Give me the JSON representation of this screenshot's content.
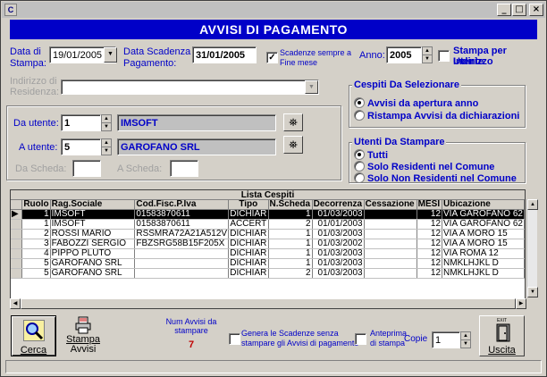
{
  "window": {
    "icon_letter": "C"
  },
  "banner": {
    "title": "AVVISI DI PAGAMENTO"
  },
  "form": {
    "data_stampa_label_1": "Data di",
    "data_stampa_label_2": "Stampa:",
    "data_stampa_value": "19/01/2005",
    "data_scadenza_label_1": "Data Scadenza",
    "data_scadenza_label_2": "Pagamento:",
    "data_scadenza_value": "31/01/2005",
    "scadenze_label_1": "Scadenze sempre a",
    "scadenze_label_2": "Fine mese",
    "scadenze_checked": true,
    "anno_label": "Anno:",
    "anno_value": "2005",
    "stampa_indirizzo_label_1": "Stampa per Indirizzo",
    "stampa_indirizzo_label_2": "Utente",
    "indirizzo_label_1": "Indirizzo di",
    "indirizzo_label_2": "Residenza:",
    "da_utente_label": "Da utente:",
    "da_utente_value": "1",
    "da_utente_name": "IMSOFT",
    "a_utente_label": "A utente:",
    "a_utente_value": "5",
    "a_utente_name": "GAROFANO SRL",
    "da_scheda_label": "Da Scheda:",
    "a_scheda_label": "A Scheda:"
  },
  "cespiti_group": {
    "title": "Cespiti Da Selezionare",
    "options": [
      "Avvisi da apertura anno",
      "Ristampa Avvisi da dichiarazioni"
    ]
  },
  "utenti_group": {
    "title": "Utenti Da Stampare",
    "options": [
      "Tutti",
      "Solo Residenti nel Comune",
      "Solo Non Residenti nel Comune"
    ]
  },
  "grid": {
    "caption": "Lista Cespiti",
    "columns": [
      "Ruolo",
      "Rag.Sociale",
      "Cod.Fisc.P.Iva",
      "Tipo",
      "N.Scheda",
      "Decorrenza",
      "Cessazione",
      "MESI",
      "Ubicazione"
    ],
    "rows": [
      [
        "1",
        "IMSOFT",
        "01583870611",
        "DICHIAR",
        "1",
        "01/03/2003",
        "",
        "12",
        "VIA GAROFANO 62"
      ],
      [
        "1",
        "IMSOFT",
        "01583870611",
        "ACCERT",
        "2",
        "01/01/2003",
        "",
        "12",
        "VIA GAROFANO 62"
      ],
      [
        "2",
        "ROSSI MARIO",
        "RSSMRA72A21A512V",
        "DICHIAR",
        "1",
        "01/03/2003",
        "",
        "12",
        "VIA A MORO 15"
      ],
      [
        "3",
        "FABOZZI SERGIO",
        "FBZSRG58B15F205X",
        "DICHIAR",
        "1",
        "01/03/2002",
        "",
        "12",
        "VIA A MORO 15"
      ],
      [
        "4",
        "PIPPO PLUTO",
        "",
        "DICHIAR",
        "1",
        "01/03/2003",
        "",
        "12",
        "VIA ROMA 12"
      ],
      [
        "5",
        "GAROFANO SRL",
        "",
        "DICHIAR",
        "1",
        "01/03/2003",
        "",
        "12",
        "NMKLHJKL D"
      ],
      [
        "5",
        "GAROFANO SRL",
        "",
        "DICHIAR",
        "2",
        "01/03/2003",
        "",
        "12",
        "NMKLHJKL D"
      ]
    ]
  },
  "footer": {
    "cerca_label": "Cerca",
    "stampa_label_1": "Stampa",
    "stampa_label_2": "Avvisi",
    "num_avvisi_label_1": "Num Avvisi da",
    "num_avvisi_label_2": "stampare",
    "num_avvisi_value": "7",
    "genera_label_1": "Genera le Scadenze senza",
    "genera_label_2": "stampare gli Avvisi di pagamento",
    "anteprima_label_1": "Anteprima",
    "anteprima_label_2": "di stampa",
    "copie_label": "Copie",
    "copie_value": "1",
    "uscita_label": "Uscita",
    "exit_badge": "EXIT"
  }
}
